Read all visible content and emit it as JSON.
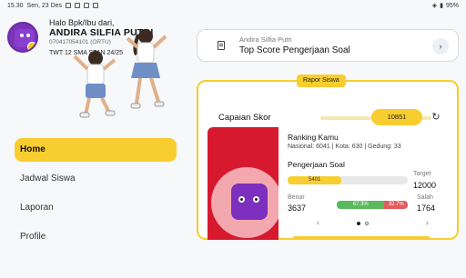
{
  "statusbar": {
    "time": "15.30",
    "date": "Sen, 23 Des",
    "battery": "95%"
  },
  "profile": {
    "greeting": "Halo Bpk/Ibu dari,",
    "name": "ANDIRA SILFIA PUTRI",
    "id": "070417054101 (ORTU)",
    "class": "TWT 12 SMA STAN 24/25"
  },
  "nav": {
    "items": [
      {
        "label": "Home",
        "active": true
      },
      {
        "label": "Jadwal Siswa",
        "active": false
      },
      {
        "label": "Laporan",
        "active": false
      },
      {
        "label": "Profile",
        "active": false
      }
    ]
  },
  "top_card": {
    "subtitle": "Andira Silfia Putri",
    "title": "Top Score Pengerjaan Soal"
  },
  "rapor": {
    "tag": "Rapor Siswa",
    "capaian_label": "Capaian Skor",
    "capaian_value": "10851",
    "ranking_title": "Ranking Kamu",
    "ranking_values": "Nasional: 6041 | Kota: 630 | Gedung: 33",
    "pengerjaan_title": "Pengerjaan Soal",
    "pengerjaan_value": "5401",
    "pengerjaan_fraction": 0.45,
    "target_label": "Target",
    "target_value": "12000",
    "benar_label": "Benar",
    "benar_value": "3637",
    "benar_pct": "67.3%",
    "salah_label": "Salah",
    "salah_value": "1764",
    "salah_pct": "32.7%"
  },
  "colors": {
    "accent": "#f8cd2f",
    "red_panel": "#d7192f",
    "mascot": "#7d2fbf"
  },
  "icons": {
    "doc": "document-icon",
    "arrow": "chevron-right-icon",
    "refresh": "refresh-icon",
    "prev": "chevron-left-icon",
    "next": "chevron-right-icon"
  }
}
